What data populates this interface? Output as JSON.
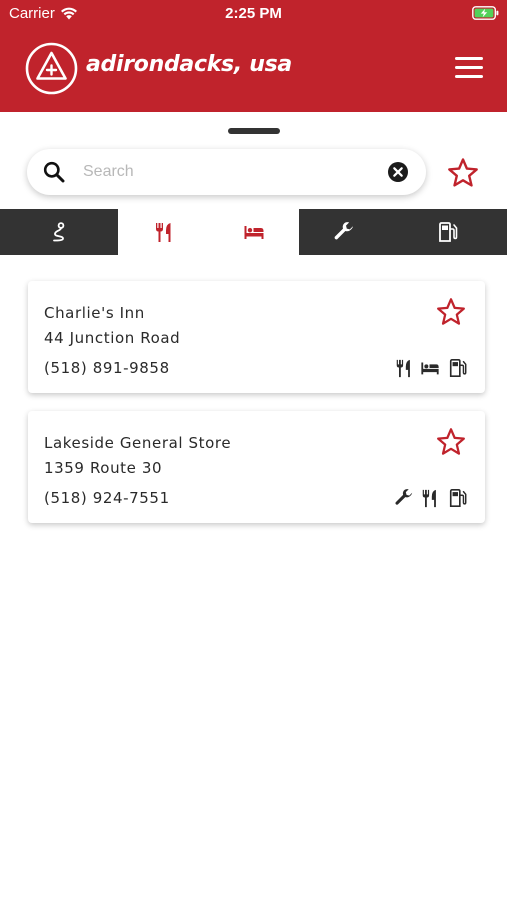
{
  "status_bar": {
    "carrier": "Carrier",
    "time": "2:25 PM"
  },
  "header": {
    "logo_text": "adirondacks, usa",
    "menu_icon": "hamburger-menu-icon"
  },
  "search": {
    "placeholder": "Search",
    "value": ""
  },
  "tabs": [
    {
      "icon": "route-icon",
      "selected": false
    },
    {
      "icon": "restaurant-icon",
      "selected": true
    },
    {
      "icon": "lodging-icon",
      "selected": true
    },
    {
      "icon": "service-wrench-icon",
      "selected": false
    },
    {
      "icon": "gas-station-icon",
      "selected": false
    }
  ],
  "places": [
    {
      "name": "Charlie's Inn",
      "address": "44 Junction Road",
      "phone": "(518) 891-9858",
      "amenities": [
        "restaurant-icon",
        "lodging-icon",
        "gas-station-icon"
      ]
    },
    {
      "name": "Lakeside General Store",
      "address": "1359 Route 30",
      "phone": "(518) 924-7551",
      "amenities": [
        "service-wrench-icon",
        "restaurant-icon",
        "gas-station-icon"
      ]
    }
  ],
  "colors": {
    "brand_red": "#c0232c",
    "tab_dark": "#333333",
    "text": "#2a2a2a"
  }
}
